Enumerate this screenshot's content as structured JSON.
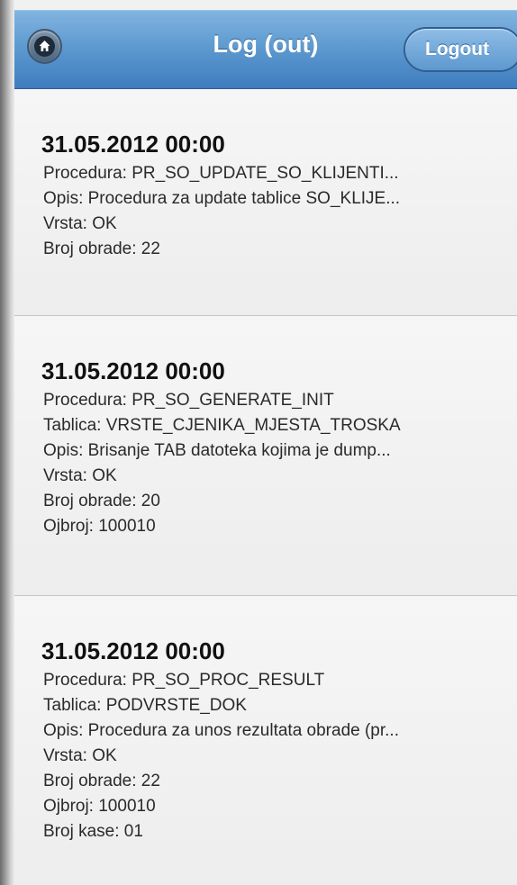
{
  "header": {
    "title": "Log (out)",
    "logout_label": "Logout",
    "home_icon": "home-icon"
  },
  "entries": [
    {
      "datetime": "31.05.2012 00:00",
      "lines": [
        "Procedura: PR_SO_UPDATE_SO_KLIJENTI...",
        "Opis: Procedura za update tablice SO_KLIJE...",
        "Vrsta: OK",
        "Broj obrade: 22"
      ]
    },
    {
      "datetime": "31.05.2012 00:00",
      "lines": [
        "Procedura: PR_SO_GENERATE_INIT",
        "Tablica: VRSTE_CJENIKA_MJESTA_TROSKA",
        "Opis: Brisanje TAB datoteka kojima je dump...",
        "Vrsta: OK",
        "Broj obrade: 20",
        "Ojbroj: 100010"
      ]
    },
    {
      "datetime": "31.05.2012 00:00",
      "lines": [
        "Procedura: PR_SO_PROC_RESULT",
        "Tablica: PODVRSTE_DOK",
        "Opis: Procedura za unos rezultata obrade (pr...",
        "Vrsta: OK",
        "Broj obrade: 22",
        "Ojbroj: 100010",
        "Broj kase: 01"
      ]
    }
  ]
}
